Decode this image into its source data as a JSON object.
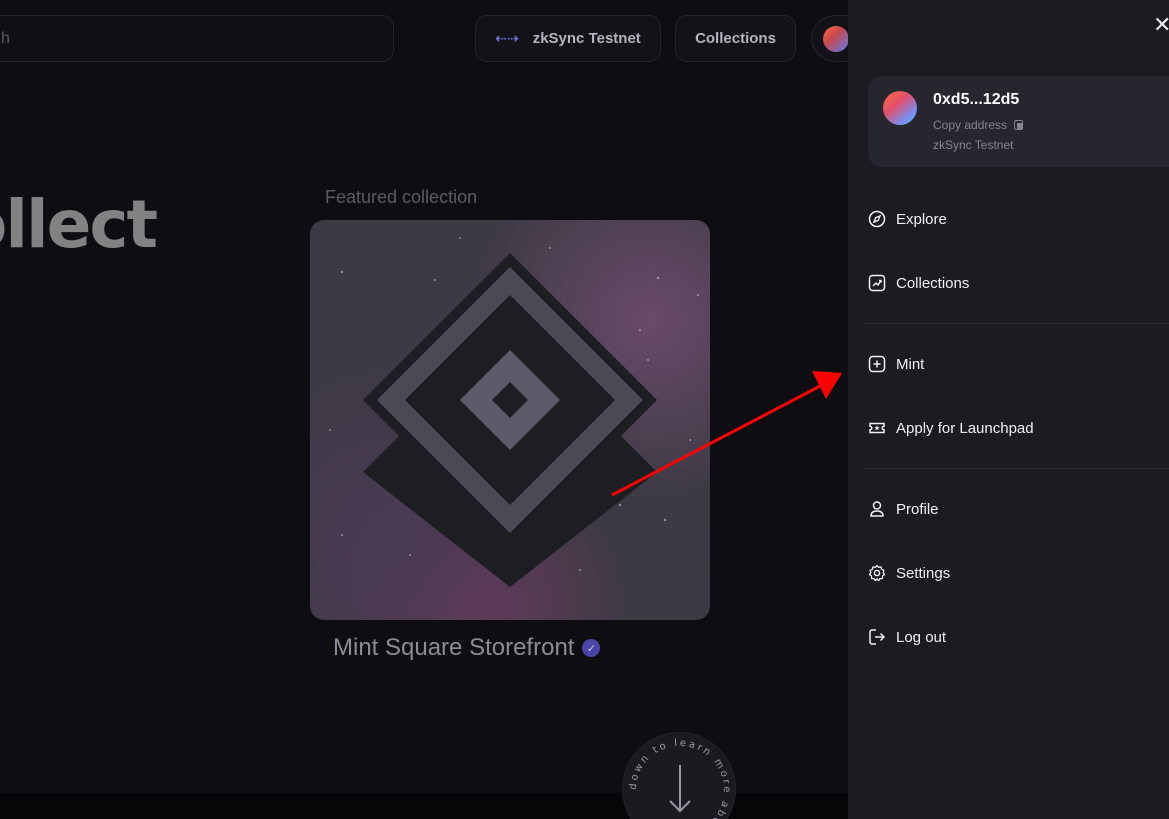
{
  "background": {
    "search": {
      "placeholder_fragment": "h"
    },
    "network_pill": {
      "label": "zkSync Testnet",
      "icon": "arrows-swap-icon"
    },
    "collections_pill": {
      "label": "Collections"
    },
    "hero_title": "ollect",
    "featured": {
      "label": "Featured collection",
      "name": "Mint Square Storefront",
      "verified_icon": "check-badge-icon"
    },
    "scroll_hint": {
      "text": "down to learn more about",
      "icon": "arrow-down-icon"
    }
  },
  "drawer": {
    "close_icon": "close-icon",
    "account": {
      "address": "0xd5...12d5",
      "copy_label": "Copy address",
      "network": "zkSync Testnet"
    },
    "menu": [
      {
        "label": "Explore",
        "icon": "compass-icon"
      },
      {
        "label": "Collections",
        "icon": "chart-icon"
      },
      {
        "label": "Mint",
        "icon": "plus-square-icon"
      },
      {
        "label": "Apply for Launchpad",
        "icon": "ticket-star-icon"
      },
      {
        "label": "Profile",
        "icon": "user-icon"
      },
      {
        "label": "Settings",
        "icon": "gear-icon"
      },
      {
        "label": "Log out",
        "icon": "logout-icon"
      }
    ]
  },
  "colors": {
    "drawer_bg": "#1b1b21",
    "card_bg": "#26262e",
    "accent_verified": "#4a46a8",
    "annotation_arrow": "#ff0000"
  }
}
